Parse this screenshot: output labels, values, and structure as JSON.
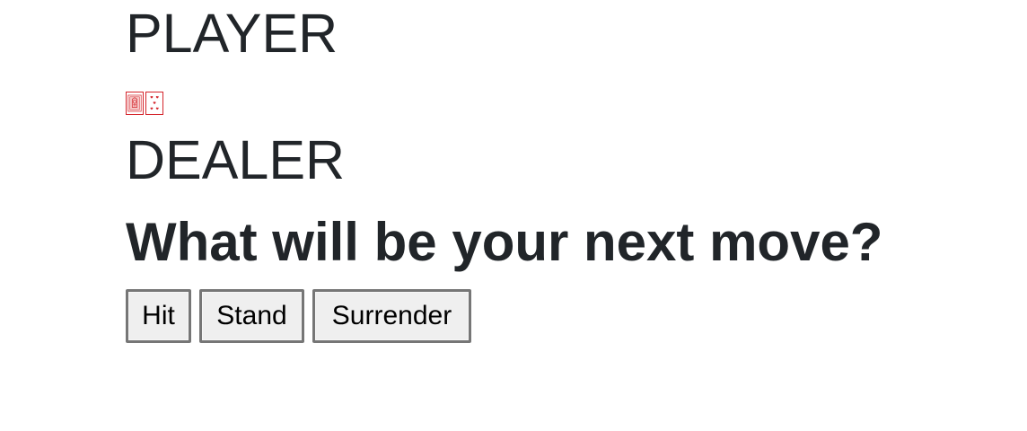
{
  "player": {
    "title": "PLAYER",
    "cards": [
      {
        "rank": "Q",
        "suit": "hearts",
        "icon": "queen-of-hearts-card-icon"
      },
      {
        "rank": "5",
        "suit": "hearts",
        "icon": "five-of-hearts-card-icon"
      }
    ]
  },
  "dealer": {
    "title": "DEALER",
    "cards": []
  },
  "prompt": "What will be your next move?",
  "actions": {
    "hit_label": "Hit",
    "stand_label": "Stand",
    "surrender_label": "Surrender"
  },
  "colors": {
    "text": "#212529",
    "card_red": "#d4242b",
    "button_bg": "#efefef",
    "button_border": "#767676"
  }
}
